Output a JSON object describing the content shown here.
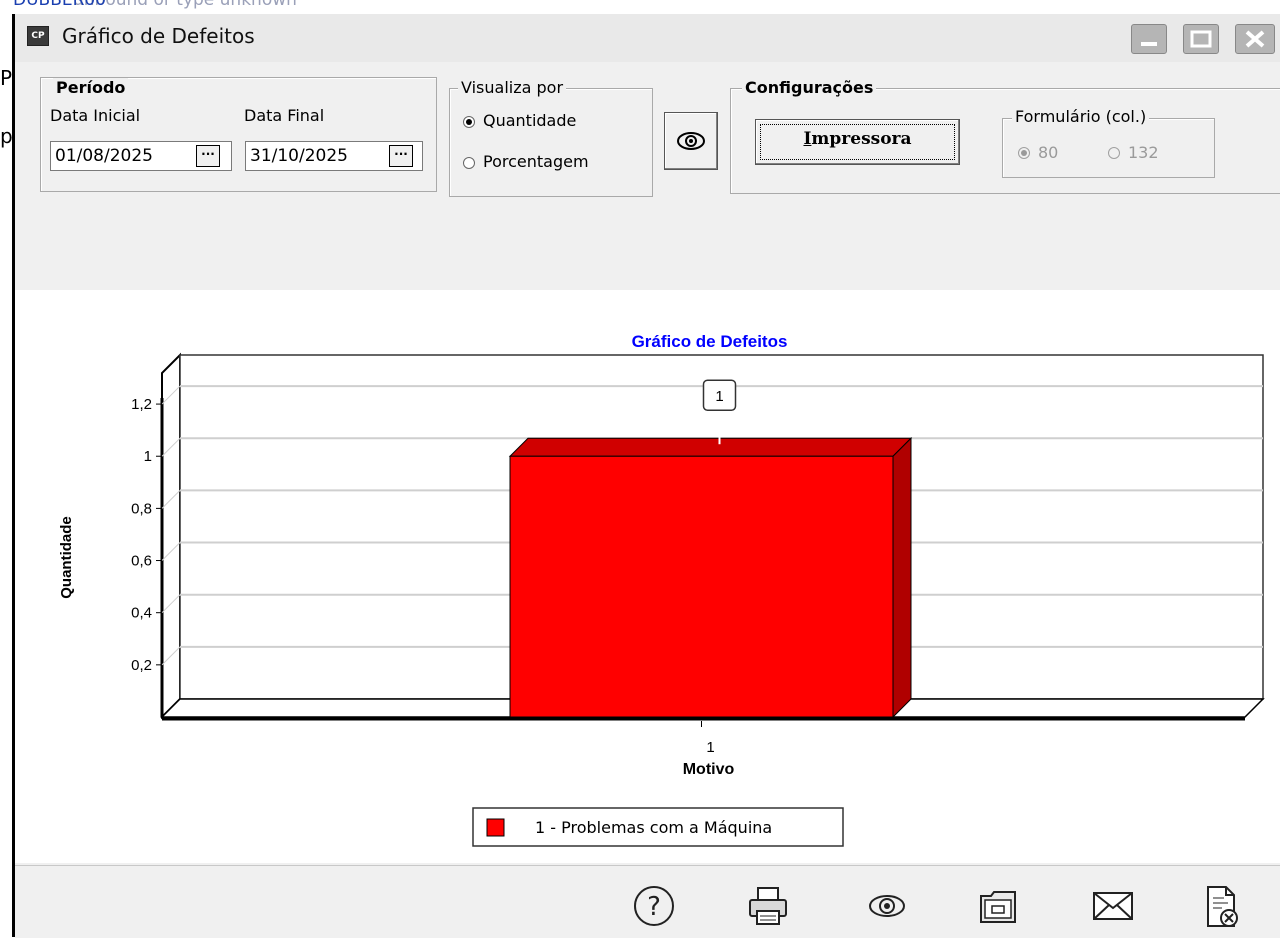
{
  "background": {
    "top_text_under": "unbound or type unknown",
    "top_text_over": "DUBBER00",
    "left_letter_1": "P",
    "left_letter_2": "p"
  },
  "window": {
    "title": "Gráfico de Defeitos",
    "app_icon_label": "CP",
    "controls": [
      "minimize-icon",
      "maximize-icon",
      "close-icon"
    ]
  },
  "periodo": {
    "legend": "Período",
    "data_inicial_label": "Data Inicial",
    "data_inicial_value": "01/08/2025",
    "data_final_label": "Data Final",
    "data_final_value": "31/10/2025",
    "picker_label": "···"
  },
  "visualiza": {
    "legend": "Visualiza por",
    "options": [
      {
        "label": "Quantidade",
        "selected": true
      },
      {
        "label": "Porcentagem",
        "selected": false
      }
    ]
  },
  "preview_button_icon": "eye-icon",
  "configuracoes": {
    "legend": "Configurações",
    "impressora_label": "Impressora",
    "impressora_accel_letter": "I",
    "formulario": {
      "legend": "Formulário (col.)",
      "options": [
        {
          "label": "80",
          "selected": true
        },
        {
          "label": "132",
          "selected": false
        }
      ]
    }
  },
  "chart_data": {
    "type": "bar",
    "title": "Gráfico de Defeitos",
    "title_color": "#0000ff",
    "xlabel": "Motivo",
    "ylabel": "Quantidade",
    "categories": [
      "1"
    ],
    "series": [
      {
        "name": "1 - Problemas com a Máquina",
        "values": [
          1
        ],
        "color": "#ff0000"
      }
    ],
    "data_labels": [
      "1"
    ],
    "y_ticks": [
      "0,2",
      "0,4",
      "0,6",
      "0,8",
      "1",
      "1,2"
    ],
    "ylim": [
      0,
      1.3
    ],
    "grid": true,
    "style": "3d",
    "legend_position": "bottom-center"
  },
  "status_bar": {
    "icons": [
      "help-icon",
      "printer-icon",
      "preview-eye-icon",
      "export-icon",
      "email-icon",
      "close-report-icon"
    ]
  }
}
